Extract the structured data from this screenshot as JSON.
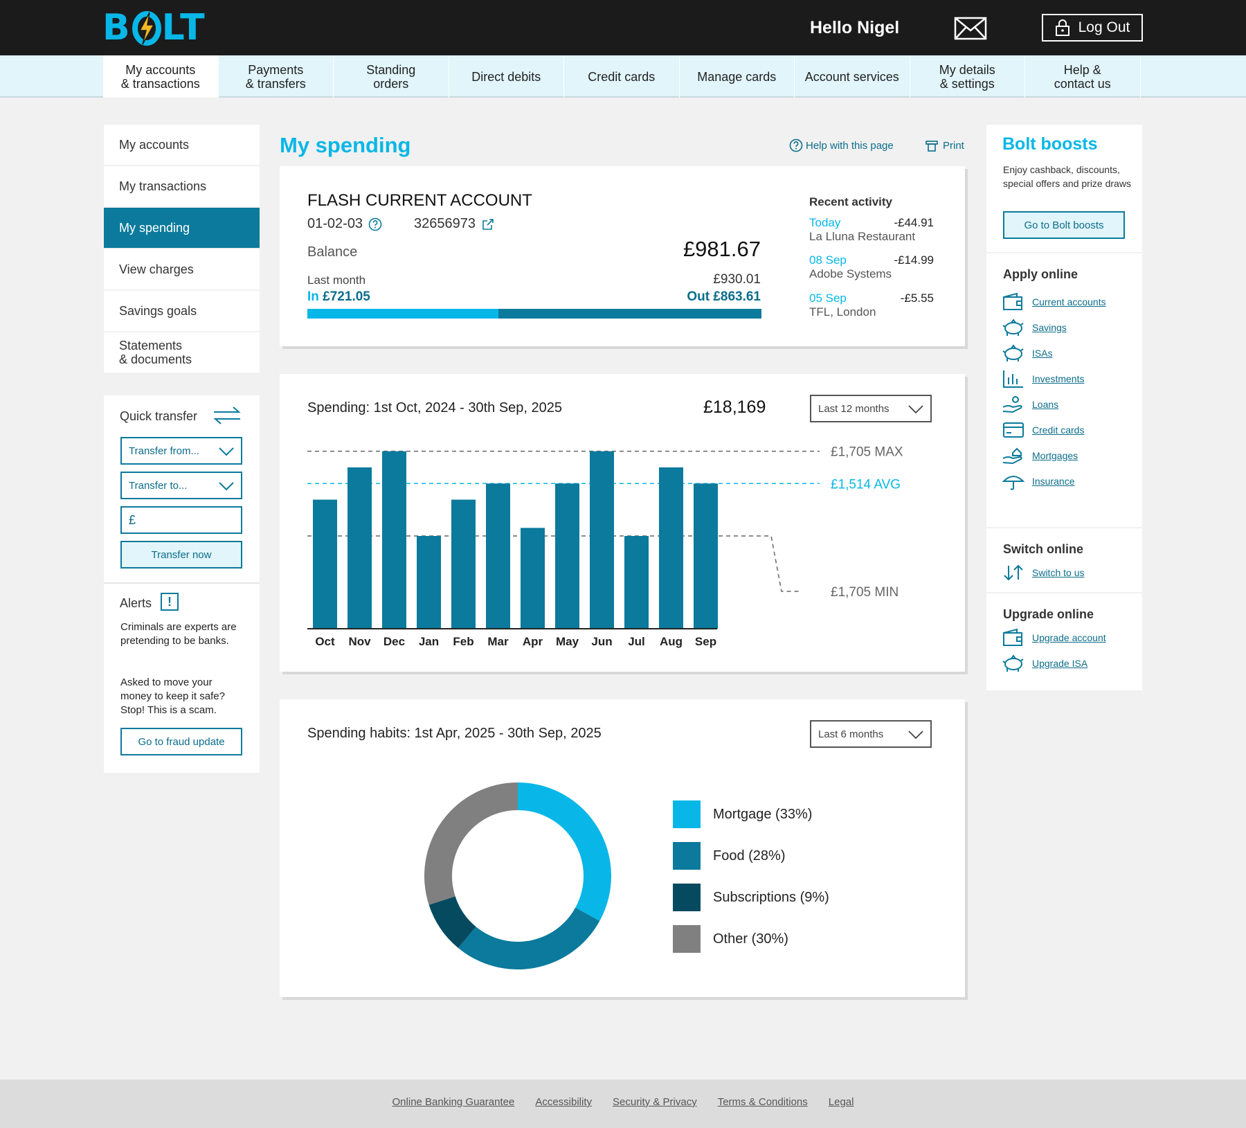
{
  "brand": {
    "logo_text_1": "B",
    "logo_text_2": "LT",
    "accent": "#08b7e7",
    "primary": "#0b7a9c",
    "dark": "#1b1b1b"
  },
  "header": {
    "greeting": "Hello Nigel",
    "mail_icon": "envelope-icon",
    "logout_label": "Log Out",
    "logout_icon": "padlock-icon"
  },
  "main_nav": [
    {
      "label": "My accounts\n& transactions",
      "active": true
    },
    {
      "label": "Payments\n& transfers"
    },
    {
      "label": "Standing\norders"
    },
    {
      "label": "Direct debits"
    },
    {
      "label": "Credit cards"
    },
    {
      "label": "Manage cards"
    },
    {
      "label": "Account services"
    },
    {
      "label": "My details\n& settings"
    },
    {
      "label": "Help &\ncontact us"
    }
  ],
  "left_nav": [
    {
      "label": "My accounts"
    },
    {
      "label": "My transactions"
    },
    {
      "label": "My spending",
      "active": true
    },
    {
      "label": "View charges"
    },
    {
      "label": "Savings goals"
    },
    {
      "label": "Statements\n& documents"
    }
  ],
  "quick_transfer": {
    "title": "Quick transfer",
    "from_placeholder": "Transfer from...",
    "to_placeholder": "Transfer to...",
    "amount_prefix": "£",
    "button": "Transfer now"
  },
  "alerts": {
    "title": "Alerts",
    "icon": "!",
    "text_1": "Criminals are experts are pretending to be banks.",
    "text_2": "Asked to move your money to keep it safe? Stop! This is a scam.",
    "button": "Go to fraud  update"
  },
  "page": {
    "title": "My spending",
    "help_link": "Help with this page",
    "print_link": "Print"
  },
  "account": {
    "name": "FLASH CURRENT ACCOUNT",
    "sort_code": "01-02-03",
    "number": "32656973",
    "balance_label": "Balance",
    "balance": "£981.67",
    "last_month_label": "Last month",
    "last_month_value": "£930.01",
    "in_prefix": "In",
    "in_value": "£721.05",
    "out_prefix": "Out",
    "out_value": "£863.61",
    "in_fraction": 0.42,
    "recent_title": "Recent activity",
    "recent": [
      {
        "date": "Today",
        "amount": "-£44.91",
        "merchant": "La Lluna Restaurant"
      },
      {
        "date": "08 Sep",
        "amount": "-£14.99",
        "merchant": "Adobe Systems"
      },
      {
        "date": "05 Sep",
        "amount": "-£5.55",
        "merchant": "TFL, London"
      }
    ]
  },
  "spending": {
    "title": "Spending: 1st Oct, 2024 - 30th Sep, 2025",
    "total": "£18,169",
    "range": "Last 12 months",
    "max_label": "£1,705 MAX",
    "avg_label": "£1,514 AVG",
    "min_label": "£1,705 MIN"
  },
  "chart_data": [
    {
      "type": "bar",
      "categories": [
        "Oct",
        "Nov",
        "Dec",
        "Jan",
        "Feb",
        "Mar",
        "Apr",
        "May",
        "Jun",
        "Jul",
        "Aug",
        "Sep"
      ],
      "values": [
        1620,
        1700,
        1740,
        1530,
        1620,
        1660,
        1550,
        1660,
        1740,
        1530,
        1700,
        1660
      ],
      "reference_lines": [
        {
          "label": "£1,705 MAX",
          "value": 1740
        },
        {
          "label": "£1,514 AVG",
          "value": 1660
        },
        {
          "label": "£1,705 MIN",
          "value": 1530
        }
      ],
      "ylim": [
        1300,
        1760
      ],
      "colors": {
        "bar": "#0b7a9c",
        "avg": "#08b7e7",
        "ref": "#666666"
      }
    },
    {
      "type": "pie",
      "title": "Spending habits: 1st Apr, 2025 - 30th Sep, 2025",
      "categories": [
        "Mortgage (33%)",
        "Food (28%)",
        "Subscriptions (9%)",
        "Other (30%)"
      ],
      "values": [
        33,
        28,
        9,
        30
      ],
      "colors": [
        "#08b7e7",
        "#0b7a9c",
        "#064a60",
        "#808080"
      ]
    }
  ],
  "habits": {
    "range": "Last 6 months"
  },
  "right": {
    "boosts_title": "Bolt boosts",
    "boosts_text": "Enjoy cashback, discounts, special offers and prize draws",
    "boosts_button": "Go to Bolt boosts",
    "apply_title": "Apply online",
    "apply_links": [
      {
        "label": "Current accounts",
        "icon": "wallet-icon"
      },
      {
        "label": "Savings",
        "icon": "piggy-bank-icon"
      },
      {
        "label": "ISAs",
        "icon": "piggy-bank-icon"
      },
      {
        "label": "Investments",
        "icon": "bar-chart-icon"
      },
      {
        "label": "Loans",
        "icon": "hand-coin-icon"
      },
      {
        "label": "Credit cards",
        "icon": "credit-card-icon"
      },
      {
        "label": "Mortgages",
        "icon": "hand-house-icon"
      },
      {
        "label": "Insurance",
        "icon": "umbrella-icon"
      }
    ],
    "switch_title": "Switch online",
    "switch_link": "Switch to us",
    "upgrade_title": "Upgrade online",
    "upgrade_links": [
      {
        "label": "Upgrade account",
        "icon": "wallet-icon"
      },
      {
        "label": "Upgrade ISA",
        "icon": "piggy-bank-icon"
      }
    ]
  },
  "footer": [
    "Online Banking Guarantee",
    "Accessibility",
    "Security & Privacy",
    "Terms & Conditions",
    "Legal"
  ]
}
